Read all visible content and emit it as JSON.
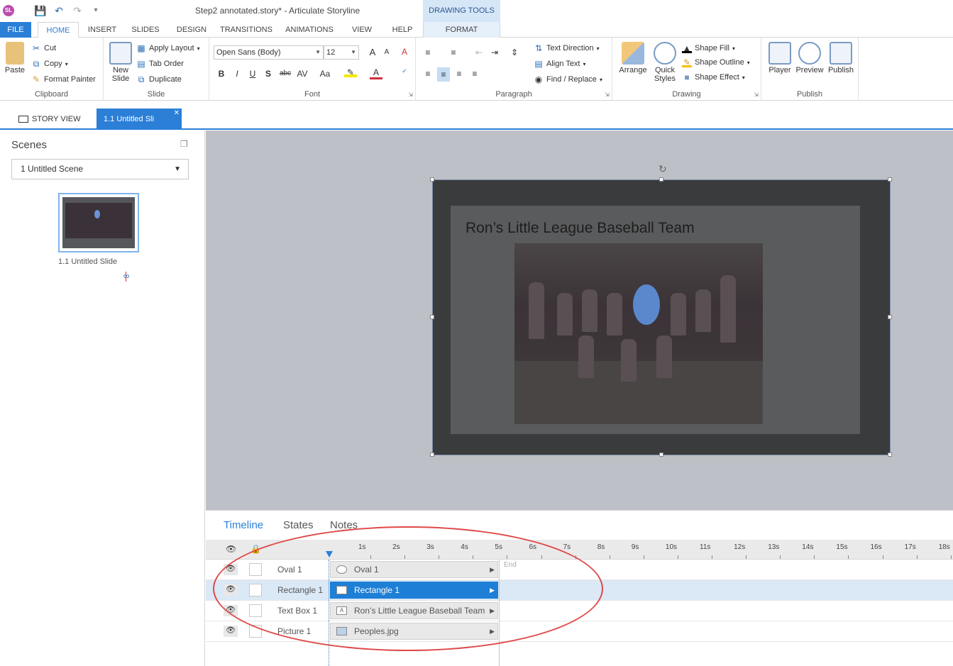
{
  "window": {
    "app_logo": "SL",
    "title": "Step2 annotated.story* - Articulate Storyline",
    "contextual_header": "DRAWING TOOLS"
  },
  "qat": {
    "save_icon": "save-icon",
    "undo_icon": "undo-icon",
    "redo_icon": "redo-icon",
    "customize_icon": "customize-icon"
  },
  "tabs": [
    {
      "label": "FILE"
    },
    {
      "label": "HOME"
    },
    {
      "label": "INSERT"
    },
    {
      "label": "SLIDES"
    },
    {
      "label": "DESIGN"
    },
    {
      "label": "TRANSITIONS"
    },
    {
      "label": "ANIMATIONS"
    },
    {
      "label": "VIEW"
    },
    {
      "label": "HELP"
    },
    {
      "label": "FORMAT"
    }
  ],
  "ribbon": {
    "clipboard": {
      "label": "Clipboard",
      "paste": "Paste",
      "cut": "Cut",
      "copy": "Copy",
      "format_painter": "Format Painter"
    },
    "slide": {
      "label": "Slide",
      "new_slide": "New Slide",
      "apply_layout": "Apply Layout",
      "tab_order": "Tab Order",
      "duplicate": "Duplicate"
    },
    "font": {
      "label": "Font",
      "family": "Open Sans (Body)",
      "size": "12",
      "bold": "B",
      "italic": "I",
      "underline": "U",
      "shadow": "S",
      "strike": "abc",
      "spacing": "AV",
      "case": "Aa",
      "grow": "A",
      "shrink": "A",
      "clear": "A"
    },
    "paragraph": {
      "label": "Paragraph",
      "text_direction": "Text Direction",
      "align_text": "Align Text",
      "find_replace": "Find / Replace"
    },
    "drawing": {
      "label": "Drawing",
      "arrange": "Arrange",
      "quick_styles": "Quick Styles",
      "shape_fill": "Shape Fill",
      "shape_outline": "Shape Outline",
      "shape_effect": "Shape Effect"
    },
    "publish": {
      "label": "Publish",
      "player": "Player",
      "preview": "Preview",
      "publish": "Publish"
    }
  },
  "view_tabs": {
    "story_view": "STORY VIEW",
    "slide_tab": "1.1 Untitled Sli"
  },
  "scenes_panel": {
    "title": "Scenes",
    "selected_scene": "1 Untitled Scene",
    "thumbnail_label": "1.1 Untitled Slide"
  },
  "slide": {
    "title": "Ron’s Little League Baseball Team"
  },
  "timeline": {
    "tabs": [
      "Timeline",
      "States",
      "Notes"
    ],
    "end_label": "End",
    "ticks": [
      "1s",
      "2s",
      "3s",
      "4s",
      "5s",
      "6s",
      "7s",
      "8s",
      "9s",
      "10s",
      "11s",
      "12s",
      "13s",
      "14s",
      "15s",
      "16s",
      "17s",
      "18s"
    ],
    "rows": [
      {
        "name": "Oval 1",
        "bar": "Oval 1",
        "icon": "oval-icon",
        "selected": false
      },
      {
        "name": "Rectangle 1",
        "bar": "Rectangle 1",
        "icon": "rectangle-icon",
        "selected": true
      },
      {
        "name": "Text Box 1",
        "bar": "Ron’s Little League Baseball Team",
        "icon": "textbox-icon",
        "selected": false
      },
      {
        "name": "Picture 1",
        "bar": "Peoples.jpg",
        "icon": "picture-icon",
        "selected": false
      }
    ]
  },
  "colors": {
    "accent": "#2b7fd6",
    "annotation": "#e04848",
    "oval": "#5b88cc"
  }
}
